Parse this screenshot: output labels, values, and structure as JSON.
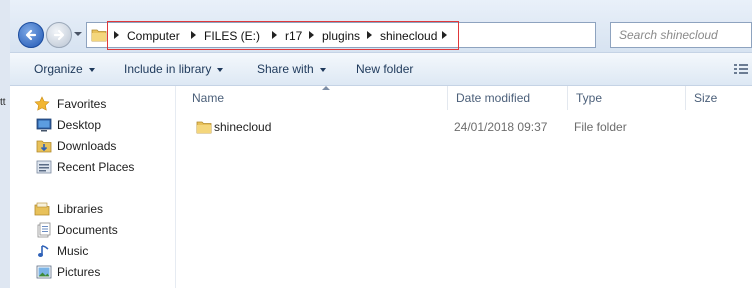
{
  "window": {
    "edge_mark": "tt"
  },
  "address": {
    "crumbs": [
      "Computer",
      "FILES (E:)",
      "r17",
      "plugins",
      "shinecloud"
    ]
  },
  "search": {
    "placeholder": "Search shinecloud"
  },
  "toolbar": {
    "items": [
      "Organize",
      "Include in library",
      "Share with",
      "New folder"
    ]
  },
  "navigation": {
    "favorites": {
      "header": "Favorites",
      "items": [
        "Desktop",
        "Downloads",
        "Recent Places"
      ]
    },
    "libraries": {
      "header": "Libraries",
      "items": [
        "Documents",
        "Music",
        "Pictures"
      ]
    }
  },
  "file_list": {
    "columns": [
      "Name",
      "Date modified",
      "Type",
      "Size"
    ],
    "rows": [
      {
        "name": "shinecloud",
        "date_modified": "24/01/2018 09:37",
        "type": "File folder",
        "size": ""
      }
    ]
  },
  "colors": {
    "highlight_box": "#e0383a",
    "folder": "#e8c15a",
    "toolbar_text": "#1e395b"
  }
}
